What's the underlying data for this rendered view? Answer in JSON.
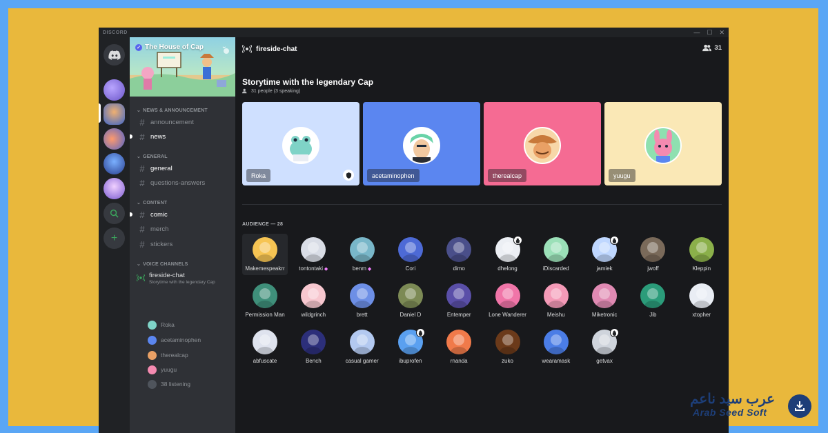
{
  "app": {
    "brand": "DISCORD"
  },
  "window_controls": {
    "minimize": "—",
    "maximize": "☐",
    "close": "✕"
  },
  "server": {
    "name": "The House of Cap"
  },
  "categories": {
    "news": "NEWS & ANNOUNCEMENT",
    "general": "GENERAL",
    "content": "CONTENT",
    "voice": "VOICE CHANNELS"
  },
  "channels": {
    "announcement": "announcement",
    "news": "news",
    "general": "general",
    "questions": "questions-answers",
    "comic": "comic",
    "merch": "merch",
    "stickers": "stickers"
  },
  "voice_channel": {
    "name": "fireside-chat",
    "topic": "Storytime with the legendary Cap",
    "users": [
      "Roka",
      "acetaminophen",
      "therealcap",
      "yuugu"
    ],
    "listening": "38 listening"
  },
  "header": {
    "channel": "fireside-chat",
    "member_count": "31"
  },
  "stage": {
    "title": "Storytime with the legendary Cap",
    "subtitle": "31 people (3 speaking)"
  },
  "speakers": [
    {
      "name": "Roka",
      "bg": "#cfe0ff",
      "av": "#7fd3c7"
    },
    {
      "name": "acetaminophen",
      "bg": "#5b86f0",
      "av": "#69d3a8"
    },
    {
      "name": "therealcap",
      "bg": "#f56b93",
      "av": "#e9a065"
    },
    {
      "name": "yuugu",
      "bg": "#fae8b6",
      "av": "#f48ab0"
    }
  ],
  "audience": {
    "heading": "AUDIENCE — 28",
    "members": [
      "Makemespeakrr",
      "tontontaki",
      "benm",
      "Cori",
      "dimo",
      "dhelong",
      "iDiscarded",
      "jamiek",
      "jwoff",
      "Kleppin",
      "Permission Man",
      "wildgrinch",
      "brett",
      "Daniel D",
      "Entemper",
      "Lone Wanderer",
      "Meishu",
      "Miketronic",
      "Jib",
      "xtopher",
      "abfuscate",
      "Bench",
      "casual gamer",
      "ibuprofen",
      "rnanda",
      "zuko",
      "wearamask",
      "getvax"
    ]
  },
  "watermark": {
    "arabic": "عرب سيد ناعم",
    "english": "Arab Seed Soft"
  }
}
